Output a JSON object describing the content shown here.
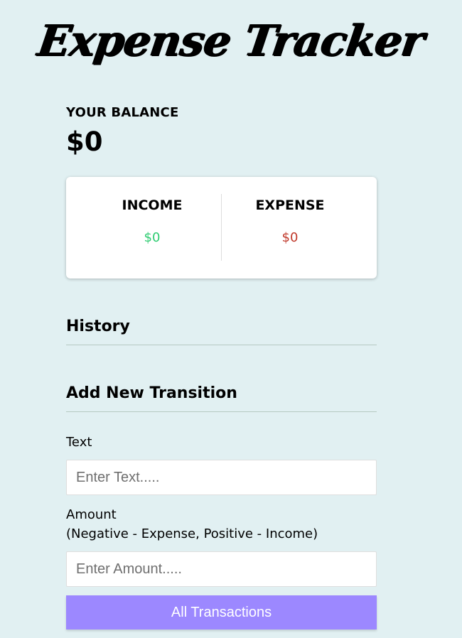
{
  "header": {
    "title": "Expense Tracker"
  },
  "balance": {
    "label": "YOUR BALANCE",
    "value": "$0"
  },
  "summary": {
    "income": {
      "label": "INCOME",
      "value": "$0",
      "color": "#2ecc71"
    },
    "expense": {
      "label": "EXPENSE",
      "value": "$0",
      "color": "#c0392b"
    }
  },
  "history": {
    "title": "History"
  },
  "add_form": {
    "title": "Add New Transition",
    "text_label": "Text",
    "text_placeholder": "Enter Text.....",
    "amount_label": "Amount",
    "amount_hint": "(Negative - Expense, Positive - Income)",
    "amount_placeholder": "Enter Amount.....",
    "submit_label": "All Transactions",
    "button_color": "#9c88ff"
  }
}
